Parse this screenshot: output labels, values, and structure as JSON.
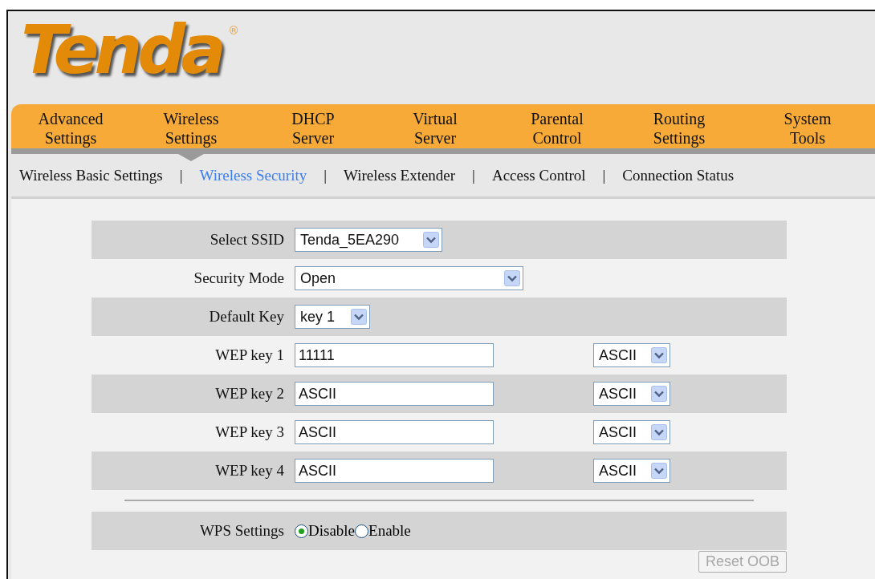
{
  "logo": {
    "wordmark": "Tenda",
    "mark": "®"
  },
  "nav": [
    {
      "lines": [
        "Advanced",
        "Settings"
      ],
      "selected": false
    },
    {
      "lines": [
        "Wireless",
        "Settings"
      ],
      "selected": true
    },
    {
      "lines": [
        "DHCP",
        "Server"
      ],
      "selected": false
    },
    {
      "lines": [
        "Virtual",
        "Server"
      ],
      "selected": false
    },
    {
      "lines": [
        "Parental",
        "Control"
      ],
      "selected": false
    },
    {
      "lines": [
        "Routing",
        "Settings"
      ],
      "selected": false
    },
    {
      "lines": [
        "System",
        "Tools"
      ],
      "selected": false
    }
  ],
  "subnav": {
    "separator": "|",
    "items": [
      {
        "label": "Wireless Basic Settings",
        "selected": false
      },
      {
        "label": "Wireless Security",
        "selected": true
      },
      {
        "label": "Wireless Extender",
        "selected": false
      },
      {
        "label": "Access Control",
        "selected": false
      },
      {
        "label": "Connection Status",
        "selected": false
      }
    ]
  },
  "form": {
    "rows": [
      {
        "kind": "select",
        "label": "Select SSID",
        "value": "Tenda_5EA290"
      },
      {
        "kind": "select",
        "label": "Security Mode",
        "value": "Open"
      },
      {
        "kind": "select",
        "label": "Default Key",
        "value": "key 1"
      },
      {
        "kind": "key",
        "label": "WEP key 1",
        "value": "11111",
        "format": "ASCII"
      },
      {
        "kind": "key",
        "label": "WEP key 2",
        "value": "ASCII",
        "format": "ASCII"
      },
      {
        "kind": "key",
        "label": "WEP key 3",
        "value": "ASCII",
        "format": "ASCII"
      },
      {
        "kind": "key",
        "label": "WEP key 4",
        "value": "ASCII",
        "format": "ASCII"
      }
    ],
    "wps": {
      "label": "WPS Settings",
      "options": [
        {
          "label": "Disable",
          "selected": true
        },
        {
          "label": "Enable",
          "selected": false
        }
      ]
    },
    "reset_button": {
      "label": "Reset OOB",
      "disabled": true
    }
  }
}
